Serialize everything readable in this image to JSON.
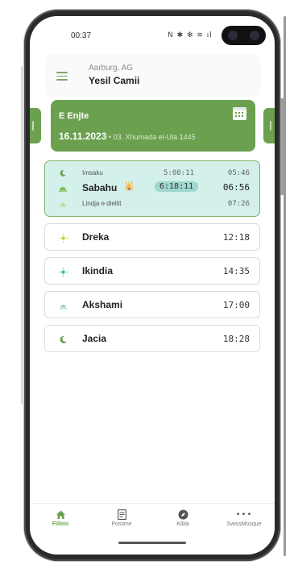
{
  "status_bar": {
    "time": "00:37",
    "icons": "N ✱ ✻ ≋ ıl"
  },
  "header": {
    "location": "Aarburg, AG",
    "mosque": "Yesil Camii"
  },
  "date_card": {
    "day_name": "E Enjte",
    "gregorian": "16.11.2023",
    "separator": " • ",
    "hijri": "03. Xhumada el-Ula 1445"
  },
  "fajr_block": {
    "imsak": {
      "label": "Imsaku",
      "countdown": "5:08:11",
      "time": "05:46"
    },
    "sabah": {
      "label": "Sabahu",
      "badge": "🕌",
      "countdown": "6:18:11",
      "time": "06:56"
    },
    "sunrise": {
      "label": "Lindja e diellit",
      "time": "07:26"
    }
  },
  "prayers": [
    {
      "name": "Dreka",
      "time": "12:18"
    },
    {
      "name": "Ikindia",
      "time": "14:35"
    },
    {
      "name": "Akshami",
      "time": "17:00"
    },
    {
      "name": "Jacia",
      "time": "18:28"
    }
  ],
  "tabs": [
    {
      "label": "Fillimi",
      "icon": "home-icon",
      "active": true
    },
    {
      "label": "Postime",
      "icon": "document-icon",
      "active": false
    },
    {
      "label": "Kibla",
      "icon": "compass-icon",
      "active": false
    },
    {
      "label": "SwissMosque",
      "icon": "more-icon",
      "active": false
    }
  ],
  "colors": {
    "accent": "#6ba04f",
    "highlight": "#d3f0ea",
    "highlight_pill": "#9fd7cf"
  }
}
